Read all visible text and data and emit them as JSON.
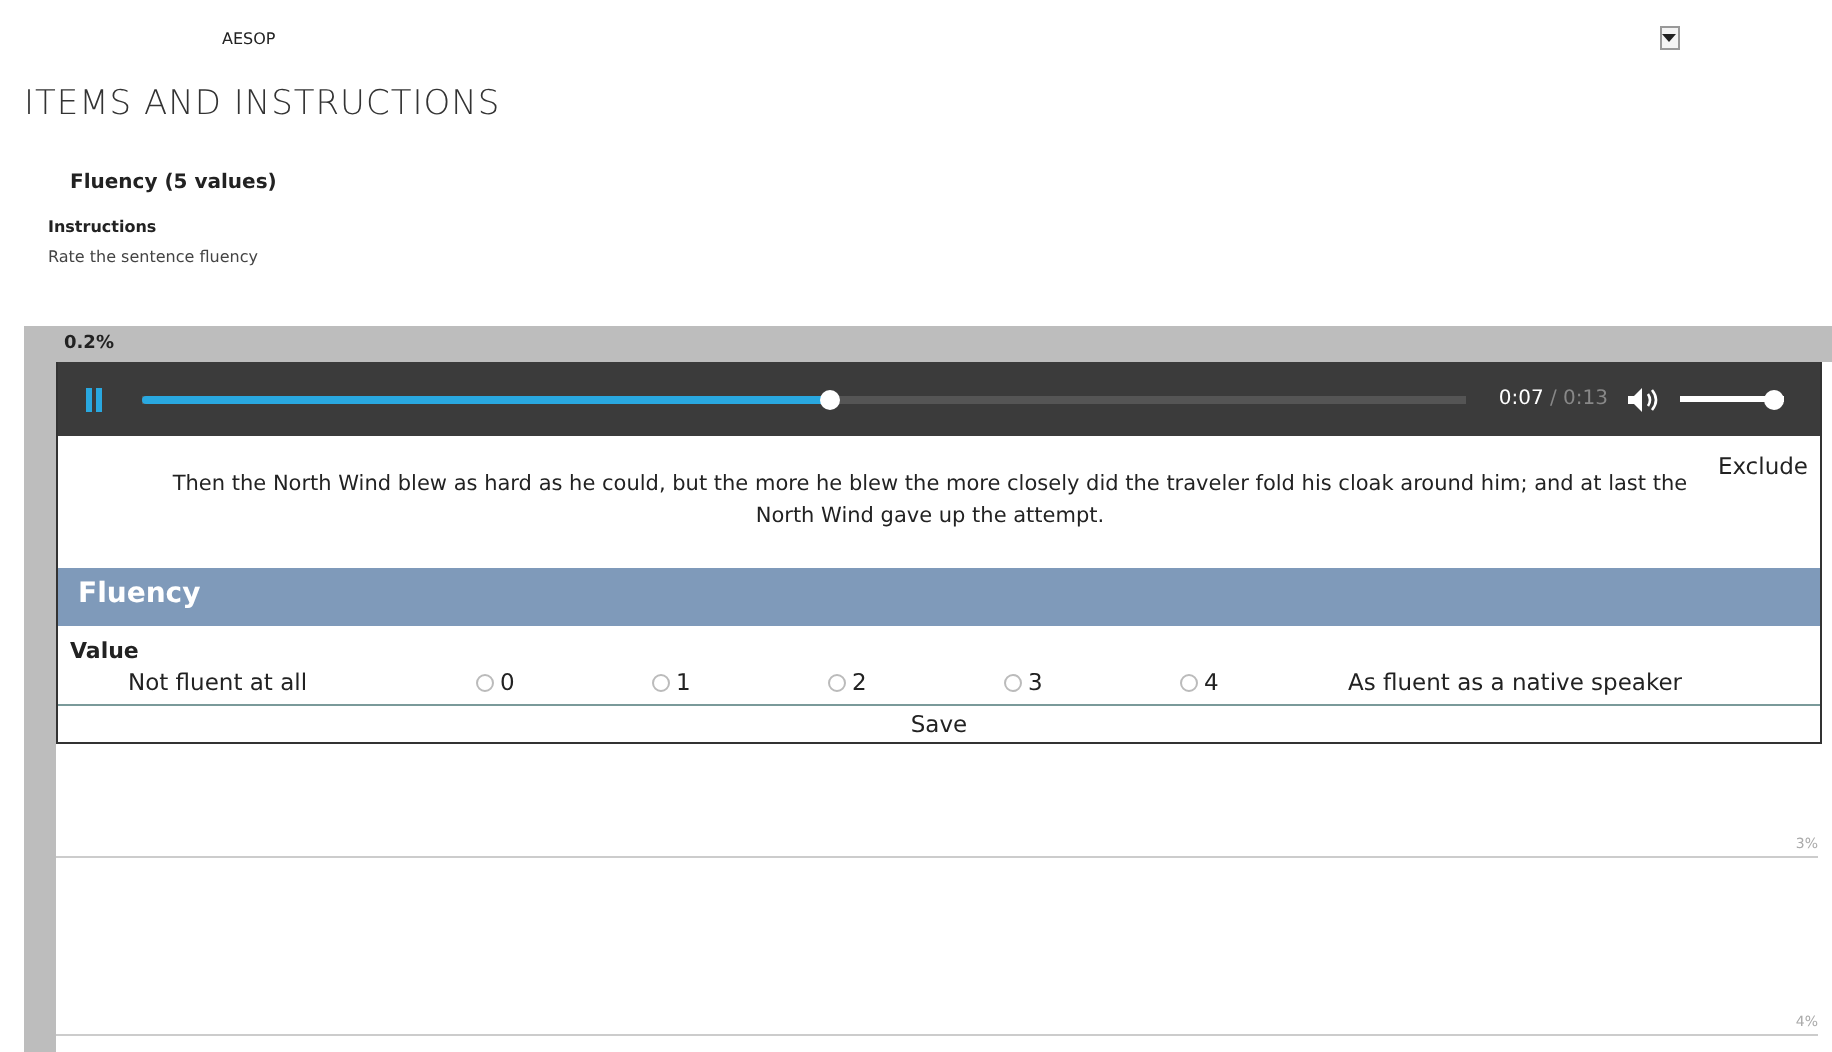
{
  "header": {
    "title": "AESOP"
  },
  "page_title": "ITEMS AND INSTRUCTIONS",
  "item": {
    "title": "Fluency (5 values)",
    "instructions_label": "Instructions",
    "instructions": "Rate the sentence fluency"
  },
  "chart": {
    "top_label": "0.2%",
    "gridlines": [
      "3%",
      "4%"
    ]
  },
  "player": {
    "playing": true,
    "level": 0.52,
    "current_time": "0:07",
    "total_time": "/ 0:13",
    "volume": {
      "level": 1
    }
  },
  "sentence": "Then the North Wind blew as hard as he could, but the more he blew the more closely did the traveler fold his cloak around him; and at last the North Wind gave up the attempt.",
  "exclude": "Exclude",
  "rating": {
    "title": "Fluency",
    "value_label": "Value",
    "low_label": "Not fluent at all",
    "high_label": "As fluent as a native speaker",
    "options": [
      {
        "label": "0",
        "selected": false
      },
      {
        "label": "1",
        "selected": false
      },
      {
        "label": "2",
        "selected": false
      },
      {
        "label": "3",
        "selected": false
      },
      {
        "label": "4",
        "selected": false
      }
    ]
  },
  "save": "Save"
}
